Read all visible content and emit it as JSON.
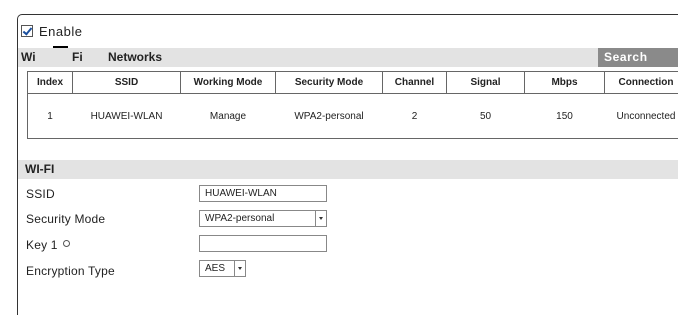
{
  "enable": {
    "label": "Enable",
    "checked": true
  },
  "networks": {
    "title_part1": "Wi",
    "title_part2": "Fi",
    "title_part3": "Networks",
    "search_label": "Search",
    "columns": [
      "Index",
      "SSID",
      "Working Mode",
      "Security Mode",
      "Channel",
      "Signal",
      "Mbps",
      "Connection"
    ],
    "rows": [
      [
        "1",
        "HUAWEI-WLAN",
        "Manage",
        "WPA2-personal",
        "2",
        "50",
        "150",
        "Unconnected"
      ]
    ]
  },
  "wifi": {
    "title": "WI-FI",
    "ssid_label": "SSID",
    "ssid_value": "HUAWEI-WLAN",
    "security_label": "Security Mode",
    "security_value": "WPA2-personal",
    "key_label": "Key 1",
    "key_value": "",
    "encryption_label": "Encryption Type",
    "encryption_value": "AES"
  },
  "colors": {
    "section_bar": "#e3e3e3",
    "search_button": "#8a8a8a",
    "checkmark": "#1a4f9e"
  }
}
